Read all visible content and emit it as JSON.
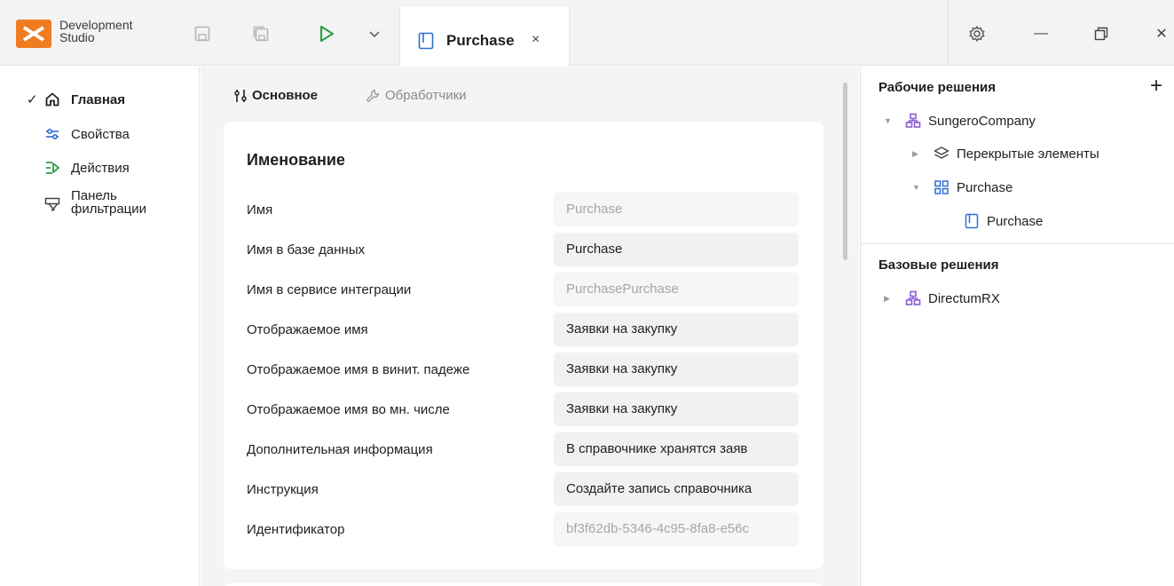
{
  "app": {
    "brand_line1": "Development",
    "brand_line2": "Studio"
  },
  "toolbar": {
    "save_icon": "save-icon",
    "save_all_icon": "save-all-icon",
    "run_icon": "play-icon",
    "run_dropdown_icon": "chevron-down-icon"
  },
  "tab": {
    "title": "Purchase",
    "close": "×"
  },
  "window": {
    "settings_icon": "gear-icon",
    "minimize": "—",
    "restore_icon": "restore-icon",
    "close": "✕"
  },
  "leftnav": {
    "items": [
      {
        "label": "Главная",
        "checked": "✓"
      },
      {
        "label": "Свойства"
      },
      {
        "label": "Действия"
      },
      {
        "label_line1": "Панель",
        "label_line2": "фильтрации"
      }
    ]
  },
  "main": {
    "tabs": [
      {
        "label": "Основное"
      },
      {
        "label": "Обработчики"
      }
    ],
    "section_title": "Именование",
    "rows": [
      {
        "label": "Имя",
        "value": "Purchase"
      },
      {
        "label": "Имя в базе данных",
        "value": "Purchase"
      },
      {
        "label": "Имя в сервисе интеграции",
        "value": "PurchasePurchase"
      },
      {
        "label": "Отображаемое имя",
        "value": "Заявки на закупку"
      },
      {
        "label": "Отображаемое имя в винит. падеже",
        "value": "Заявки на закупку"
      },
      {
        "label": "Отображаемое имя во мн. числе",
        "value": "Заявки на закупку"
      },
      {
        "label": "Дополнительная информация",
        "value": "В справочнике хранятся заяв"
      },
      {
        "label": "Инструкция",
        "value": "Создайте запись справочника"
      },
      {
        "label": "Идентификатор",
        "value": "bf3f62db-5346-4c95-8fa8-e56c"
      }
    ]
  },
  "right": {
    "work_title": "Рабочие решения",
    "add": "+",
    "work_tree": [
      {
        "label": "SungeroCompany"
      },
      {
        "label": "Перекрытые элементы"
      },
      {
        "label": "Purchase"
      },
      {
        "label": "Purchase"
      }
    ],
    "base_title": "Базовые решения",
    "base_tree": [
      {
        "label": "DirectumRX"
      }
    ]
  },
  "colors": {
    "accent_orange": "#f07c22",
    "run_green": "#2ea043",
    "solution_purple": "#8a5cd6",
    "icon_blue": "#2f6fd1"
  }
}
